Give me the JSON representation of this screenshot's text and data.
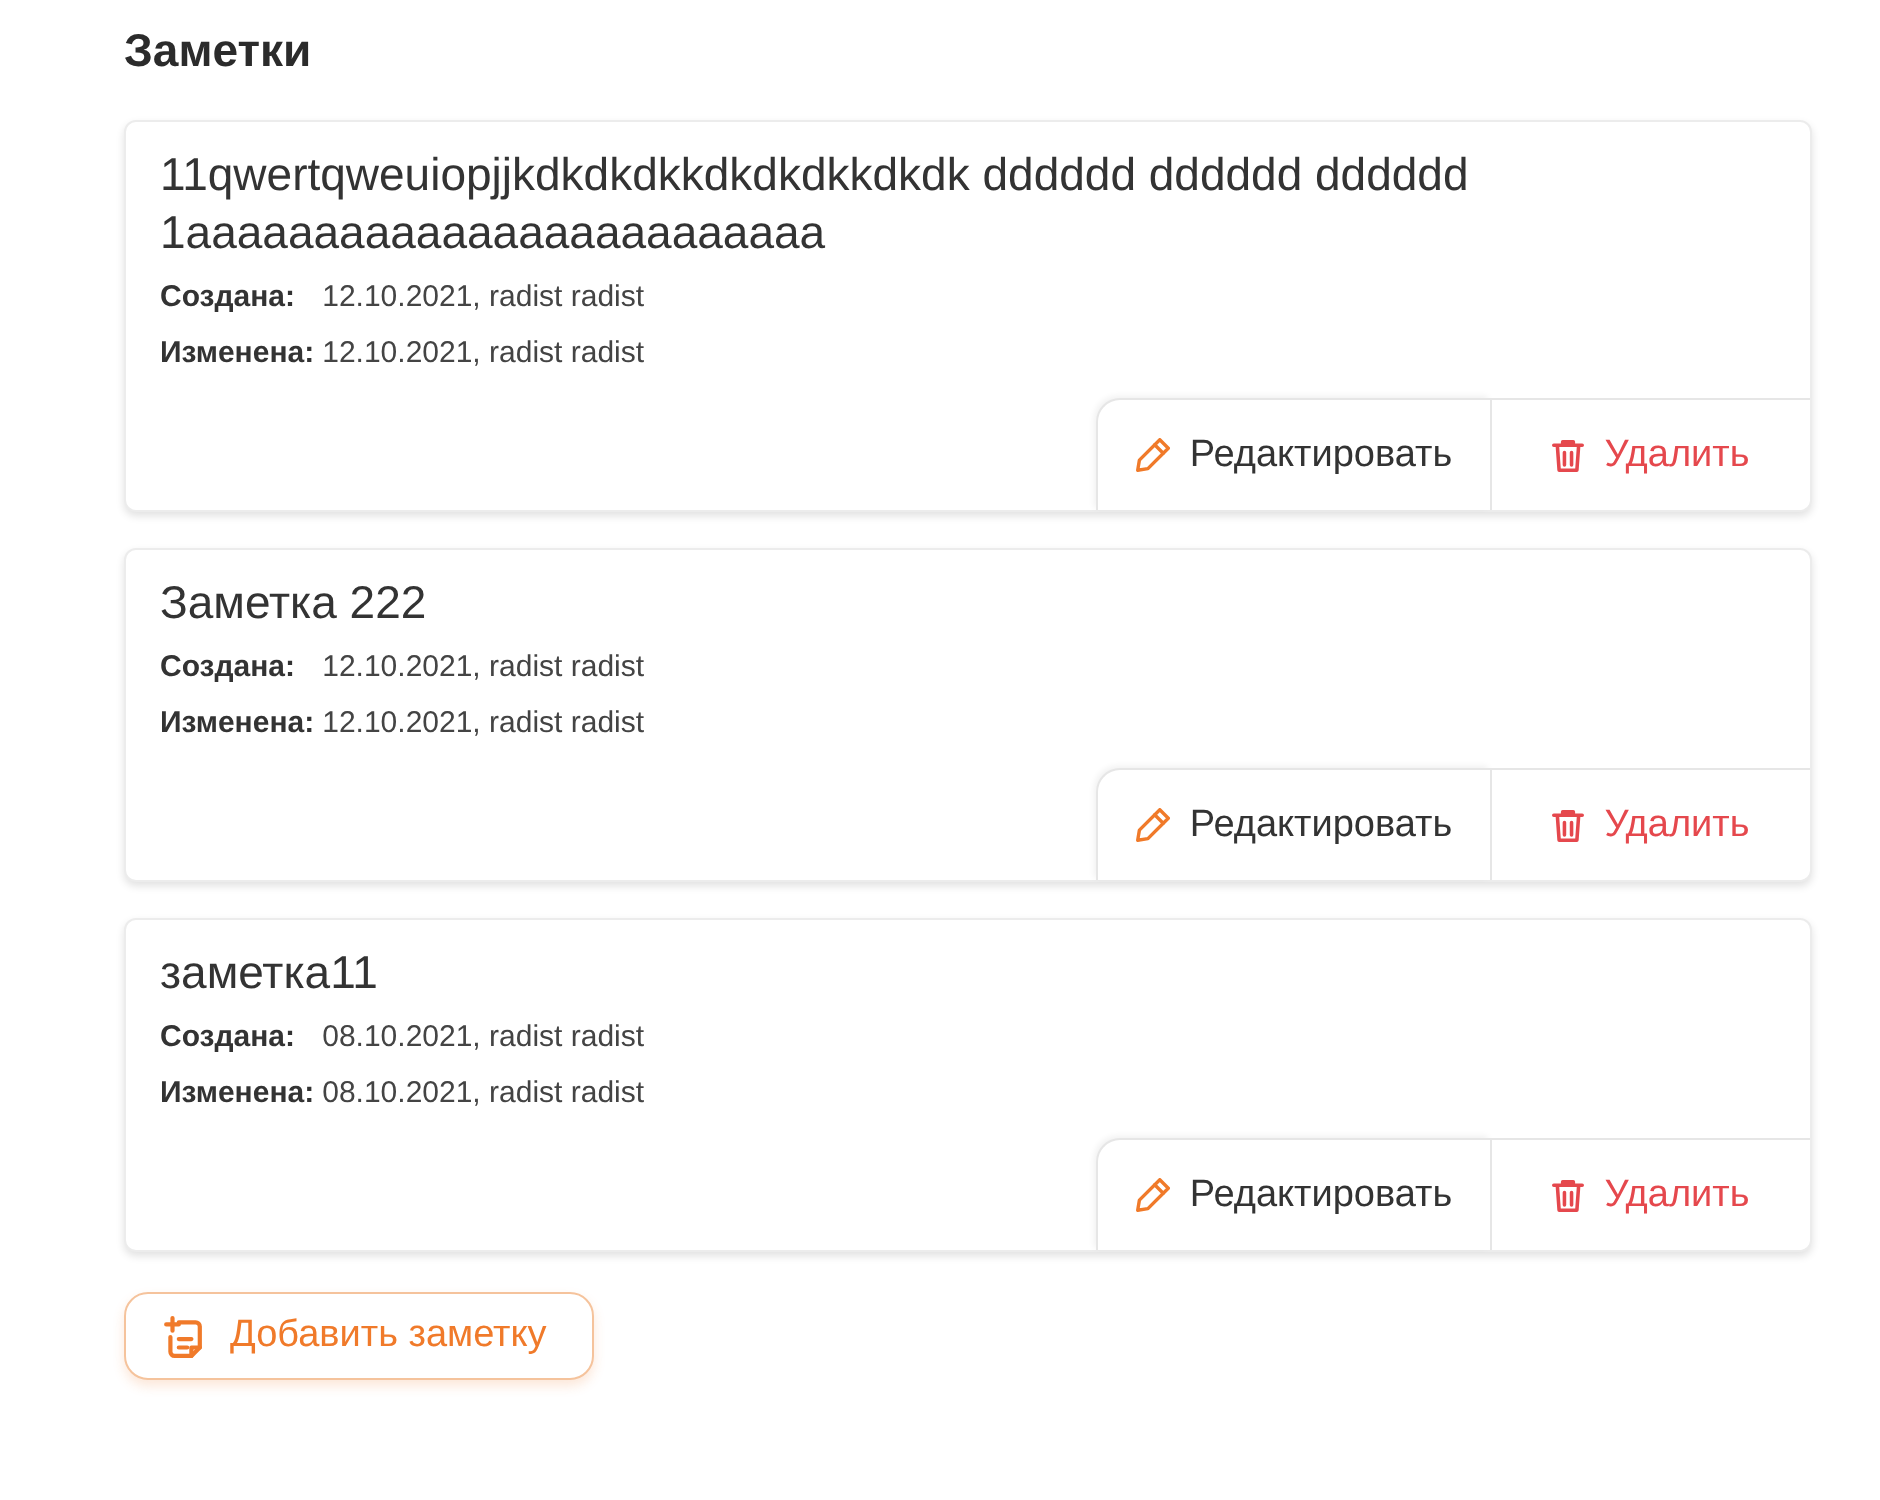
{
  "title": "Заметки",
  "notes": [
    {
      "title": "11qwertqweuiopjjkdkdkdkkdkdkdkkdkdk dddddd dddddd dddddd 1aaaaaaaaaaaaaaaaaaaaaaaaa",
      "meta": [
        {
          "label": "Создана:",
          "value": "12.10.2021, radist radist"
        },
        {
          "label": "Изменена:",
          "value": "12.10.2021, radist radist"
        }
      ],
      "actions": [
        {
          "kind": "edit",
          "label": "Редактировать"
        },
        {
          "kind": "delete",
          "label": "Удалить"
        }
      ]
    },
    {
      "title": "Заметка 222",
      "meta": [
        {
          "label": "Создана:",
          "value": "12.10.2021, radist radist"
        },
        {
          "label": "Изменена:",
          "value": "12.10.2021, radist radist"
        }
      ],
      "actions": [
        {
          "kind": "edit",
          "label": "Редактировать"
        },
        {
          "kind": "delete",
          "label": "Удалить"
        }
      ]
    },
    {
      "title": "заметка11",
      "meta": [
        {
          "label": "Создана:",
          "value": "08.10.2021, radist radist"
        },
        {
          "label": "Изменена:",
          "value": "08.10.2021, radist radist"
        }
      ],
      "actions": [
        {
          "kind": "edit",
          "label": "Редактировать"
        },
        {
          "kind": "delete",
          "label": "Удалить"
        }
      ]
    }
  ],
  "add_button": {
    "label": "Добавить заметку"
  }
}
